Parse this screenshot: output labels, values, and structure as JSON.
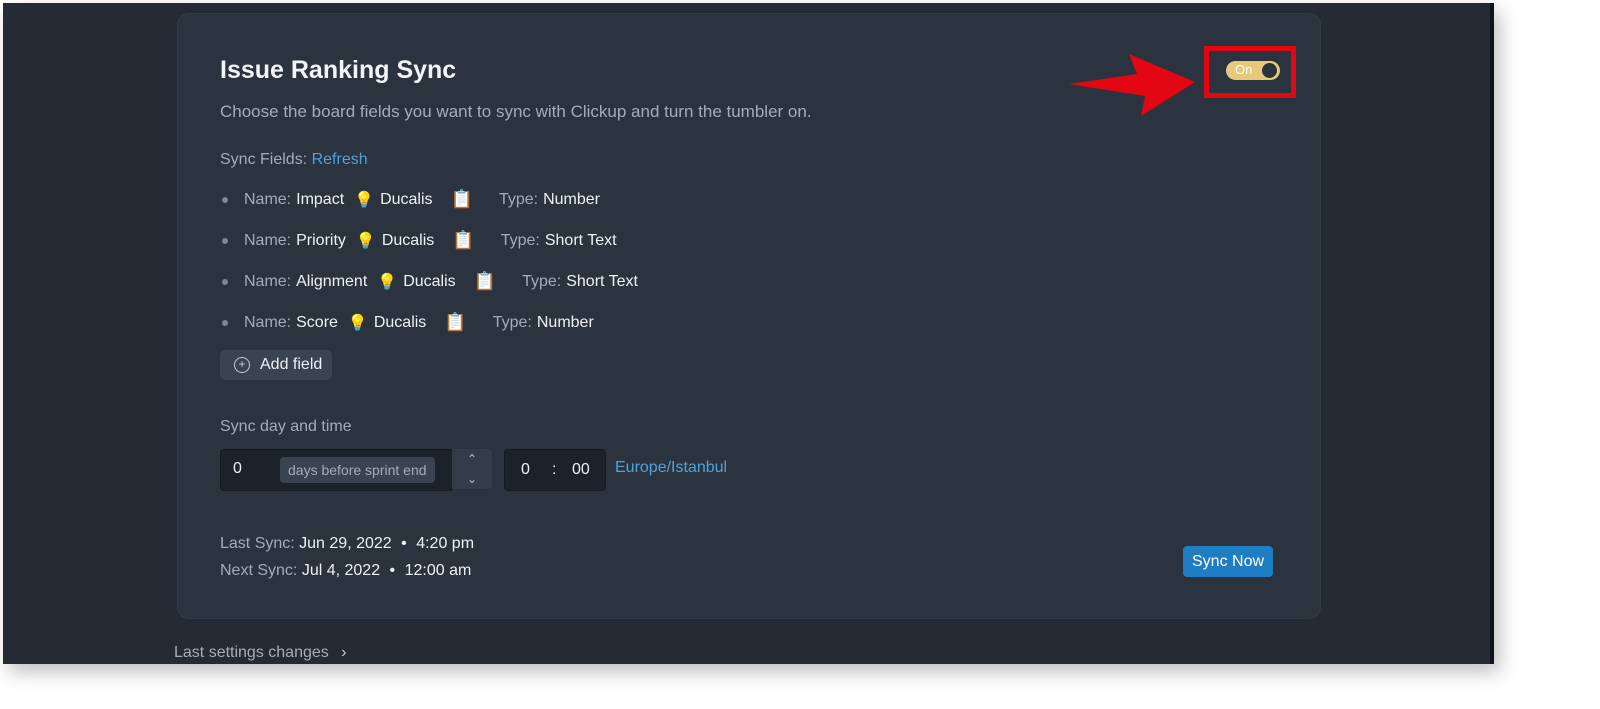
{
  "card": {
    "title": "Issue Ranking Sync",
    "description": "Choose the board fields you want to sync with Clickup and turn the tumbler on.",
    "toggle": {
      "label": "On",
      "state": "on",
      "color": "#e8c97b"
    },
    "annotation": {
      "color": "#e30613",
      "type": "red arrow with highlight box around toggle"
    }
  },
  "sync_fields": {
    "label": "Sync Fields:",
    "refresh_link": "Refresh",
    "name_label": "Name:",
    "type_label": "Type:",
    "source_icon": "lightbulb-icon",
    "copy_icon": "clipboard-icon",
    "items": [
      {
        "name": "Impact",
        "source": "Ducalis",
        "type": "Number"
      },
      {
        "name": "Priority",
        "source": "Ducalis",
        "type": "Short Text"
      },
      {
        "name": "Alignment",
        "source": "Ducalis",
        "type": "Short Text"
      },
      {
        "name": "Score",
        "source": "Ducalis",
        "type": "Number"
      }
    ],
    "add_field": "Add field"
  },
  "schedule": {
    "label": "Sync day and time",
    "days_value": "0",
    "days_suffix": "days before sprint end",
    "hour": "0",
    "separator": ":",
    "minute": "00",
    "timezone": "Europe/Istanbul"
  },
  "status": {
    "last_label": "Last Sync:",
    "last_date": "Jun 29, 2022",
    "last_time": "4:20 pm",
    "next_label": "Next Sync:",
    "next_date": "Jul 4, 2022",
    "next_time": "12:00 am",
    "bullet": "•"
  },
  "sync_now": "Sync Now",
  "footer": {
    "last_settings": "Last settings changes"
  },
  "colors": {
    "background": "#242b35",
    "card": "#2b333e",
    "link": "#4ea3dd",
    "primary_button": "#1f7ec3"
  }
}
